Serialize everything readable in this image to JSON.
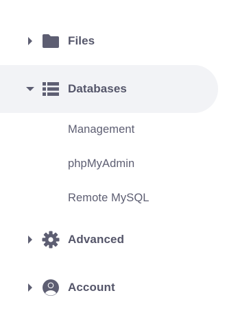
{
  "sidebar": {
    "items": [
      {
        "label": "Files",
        "icon": "folder-icon",
        "expanded": false
      },
      {
        "label": "Databases",
        "icon": "database-icon",
        "expanded": true,
        "children": [
          {
            "label": "Management"
          },
          {
            "label": "phpMyAdmin"
          },
          {
            "label": "Remote MySQL"
          }
        ]
      },
      {
        "label": "Advanced",
        "icon": "gear-icon",
        "expanded": false
      },
      {
        "label": "Account",
        "icon": "user-circle-icon",
        "expanded": false
      }
    ]
  },
  "colors": {
    "text": "#55566a",
    "icon": "#5d5e72",
    "active_bg": "#f2f3f6"
  }
}
